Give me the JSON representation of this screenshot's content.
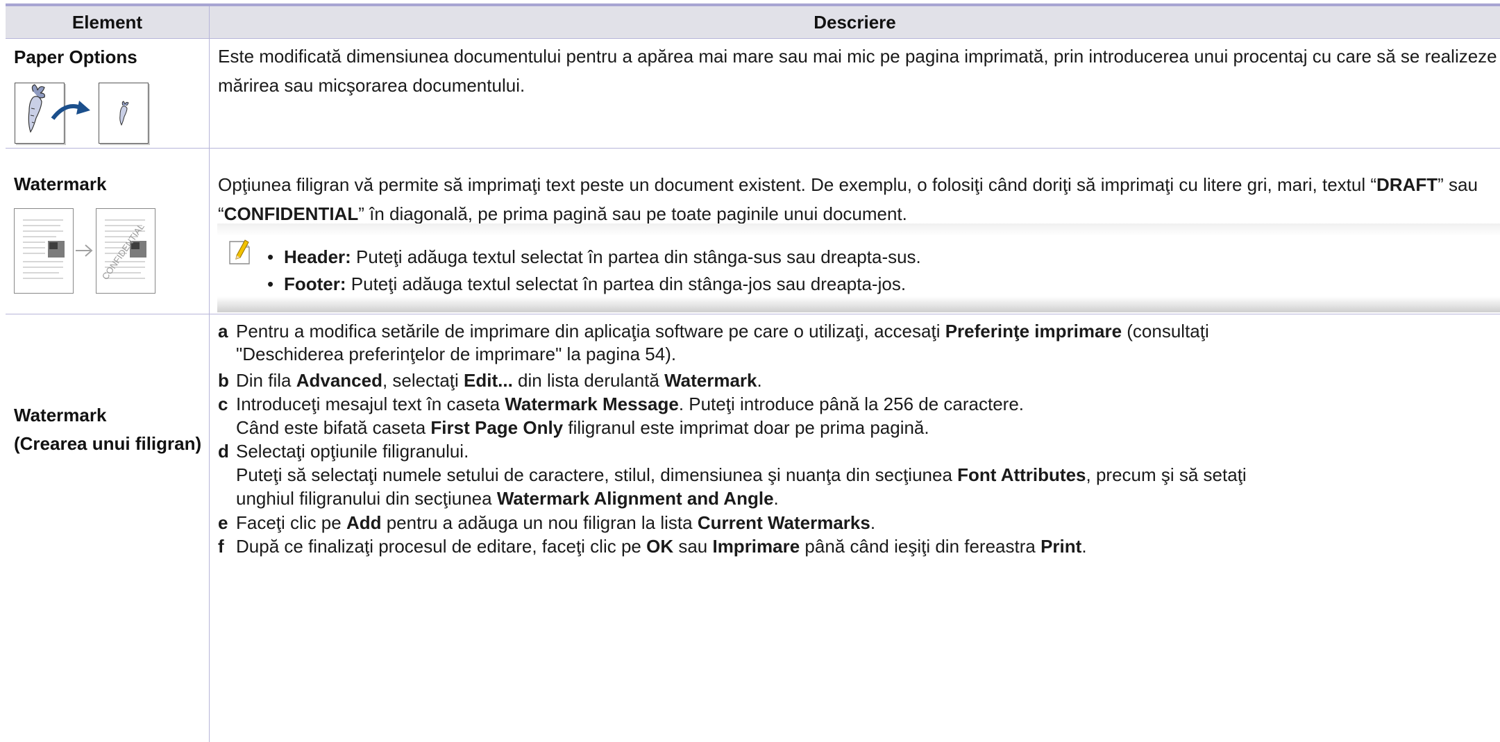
{
  "table": {
    "header": {
      "element": "Element",
      "description": "Descriere"
    },
    "rows": [
      {
        "element": "Paper Options",
        "description": "Este modificată dimensiunea documentului pentru a apărea mai mare sau mai mic pe pagina imprimată, prin introducerea unui procentaj cu care să se realizeze mărirea sau micşorarea documentului."
      },
      {
        "element": "Watermark",
        "description": {
          "t1": "Opţiunea filigran vă permite să imprimaţi text peste un document existent. De exemplu, o folosiţi când doriţi să imprimaţi cu litere gri, mari, textul “",
          "b1": "DRAFT",
          "t2": "” sau “",
          "b2": "CONFIDENTIAL",
          "t3": "” în diagonală, pe prima pagină sau pe toate paginile unui document."
        },
        "thumbnail_text": "CONFIDENTIAL",
        "note": [
          {
            "label": "Header:",
            "text": " Puteţi adăuga textul selectat în partea din stânga-sus sau dreapta-sus."
          },
          {
            "label": "Footer:",
            "text": " Puteţi adăuga textul selectat în partea din stânga-jos sau dreapta-jos."
          }
        ]
      },
      {
        "element": "Watermark",
        "element_sub": "(Crearea unui filigran)",
        "steps": {
          "a": {
            "letter": "a",
            "t1": "Pentru a modifica setările de imprimare din aplicaţia software pe care o utilizaţi, accesaţi ",
            "b1": "Preferinţe imprimare",
            "t2": " (consultaţi",
            "line2": "\"Deschiderea preferinţelor de imprimare\" la pagina 54)."
          },
          "b": {
            "letter": "b",
            "t1": "Din fila ",
            "b1": "Advanced",
            "t2": ", selectaţi ",
            "b2": "Edit...",
            "t3": " din lista derulantă ",
            "b3": "Watermark",
            "t4": "."
          },
          "c": {
            "letter": "c",
            "t1": "Introduceţi mesajul text în caseta ",
            "b1": "Watermark Message",
            "t2": ". Puteţi introduce până la 256 de caractere.",
            "sub_t1": "Când este bifată caseta ",
            "sub_b1": "First Page Only",
            "sub_t2": " filigranul este imprimat doar pe prima pagină."
          },
          "d": {
            "letter": "d",
            "t1": "Selectaţi opţiunile filigranului.",
            "sub_t1": "Puteţi să selectaţi numele setului de caractere, stilul, dimensiunea şi nuanţa din secţiunea ",
            "sub_b1": "Font Attributes",
            "sub_t2": ", precum şi să setaţi",
            "sub2_t1": "unghiul filigranului din secţiunea ",
            "sub2_b1": "Watermark Alignment and Angle",
            "sub2_t2": "."
          },
          "e": {
            "letter": "e",
            "t1": "Faceţi clic pe ",
            "b1": "Add",
            "t2": " pentru a adăuga un nou filigran la lista ",
            "b2": "Current Watermarks",
            "t3": "."
          },
          "f": {
            "letter": "f",
            "t1": "După ce finalizaţi procesul de editare, faceţi clic pe ",
            "b1": "OK",
            "t2": " sau ",
            "b2": "Imprimare",
            "t3": " până când ieşiţi din fereastra ",
            "b3": "Print",
            "t4": "."
          }
        }
      }
    ]
  },
  "colors": {
    "rule": "#b7b5d9",
    "top_bar": "#a7a5d2",
    "header_bg": "#e1e1e8",
    "arrow_blue": "#1b4f8c"
  },
  "icons": [
    "pencil-note-icon",
    "arrow-right-icon"
  ]
}
